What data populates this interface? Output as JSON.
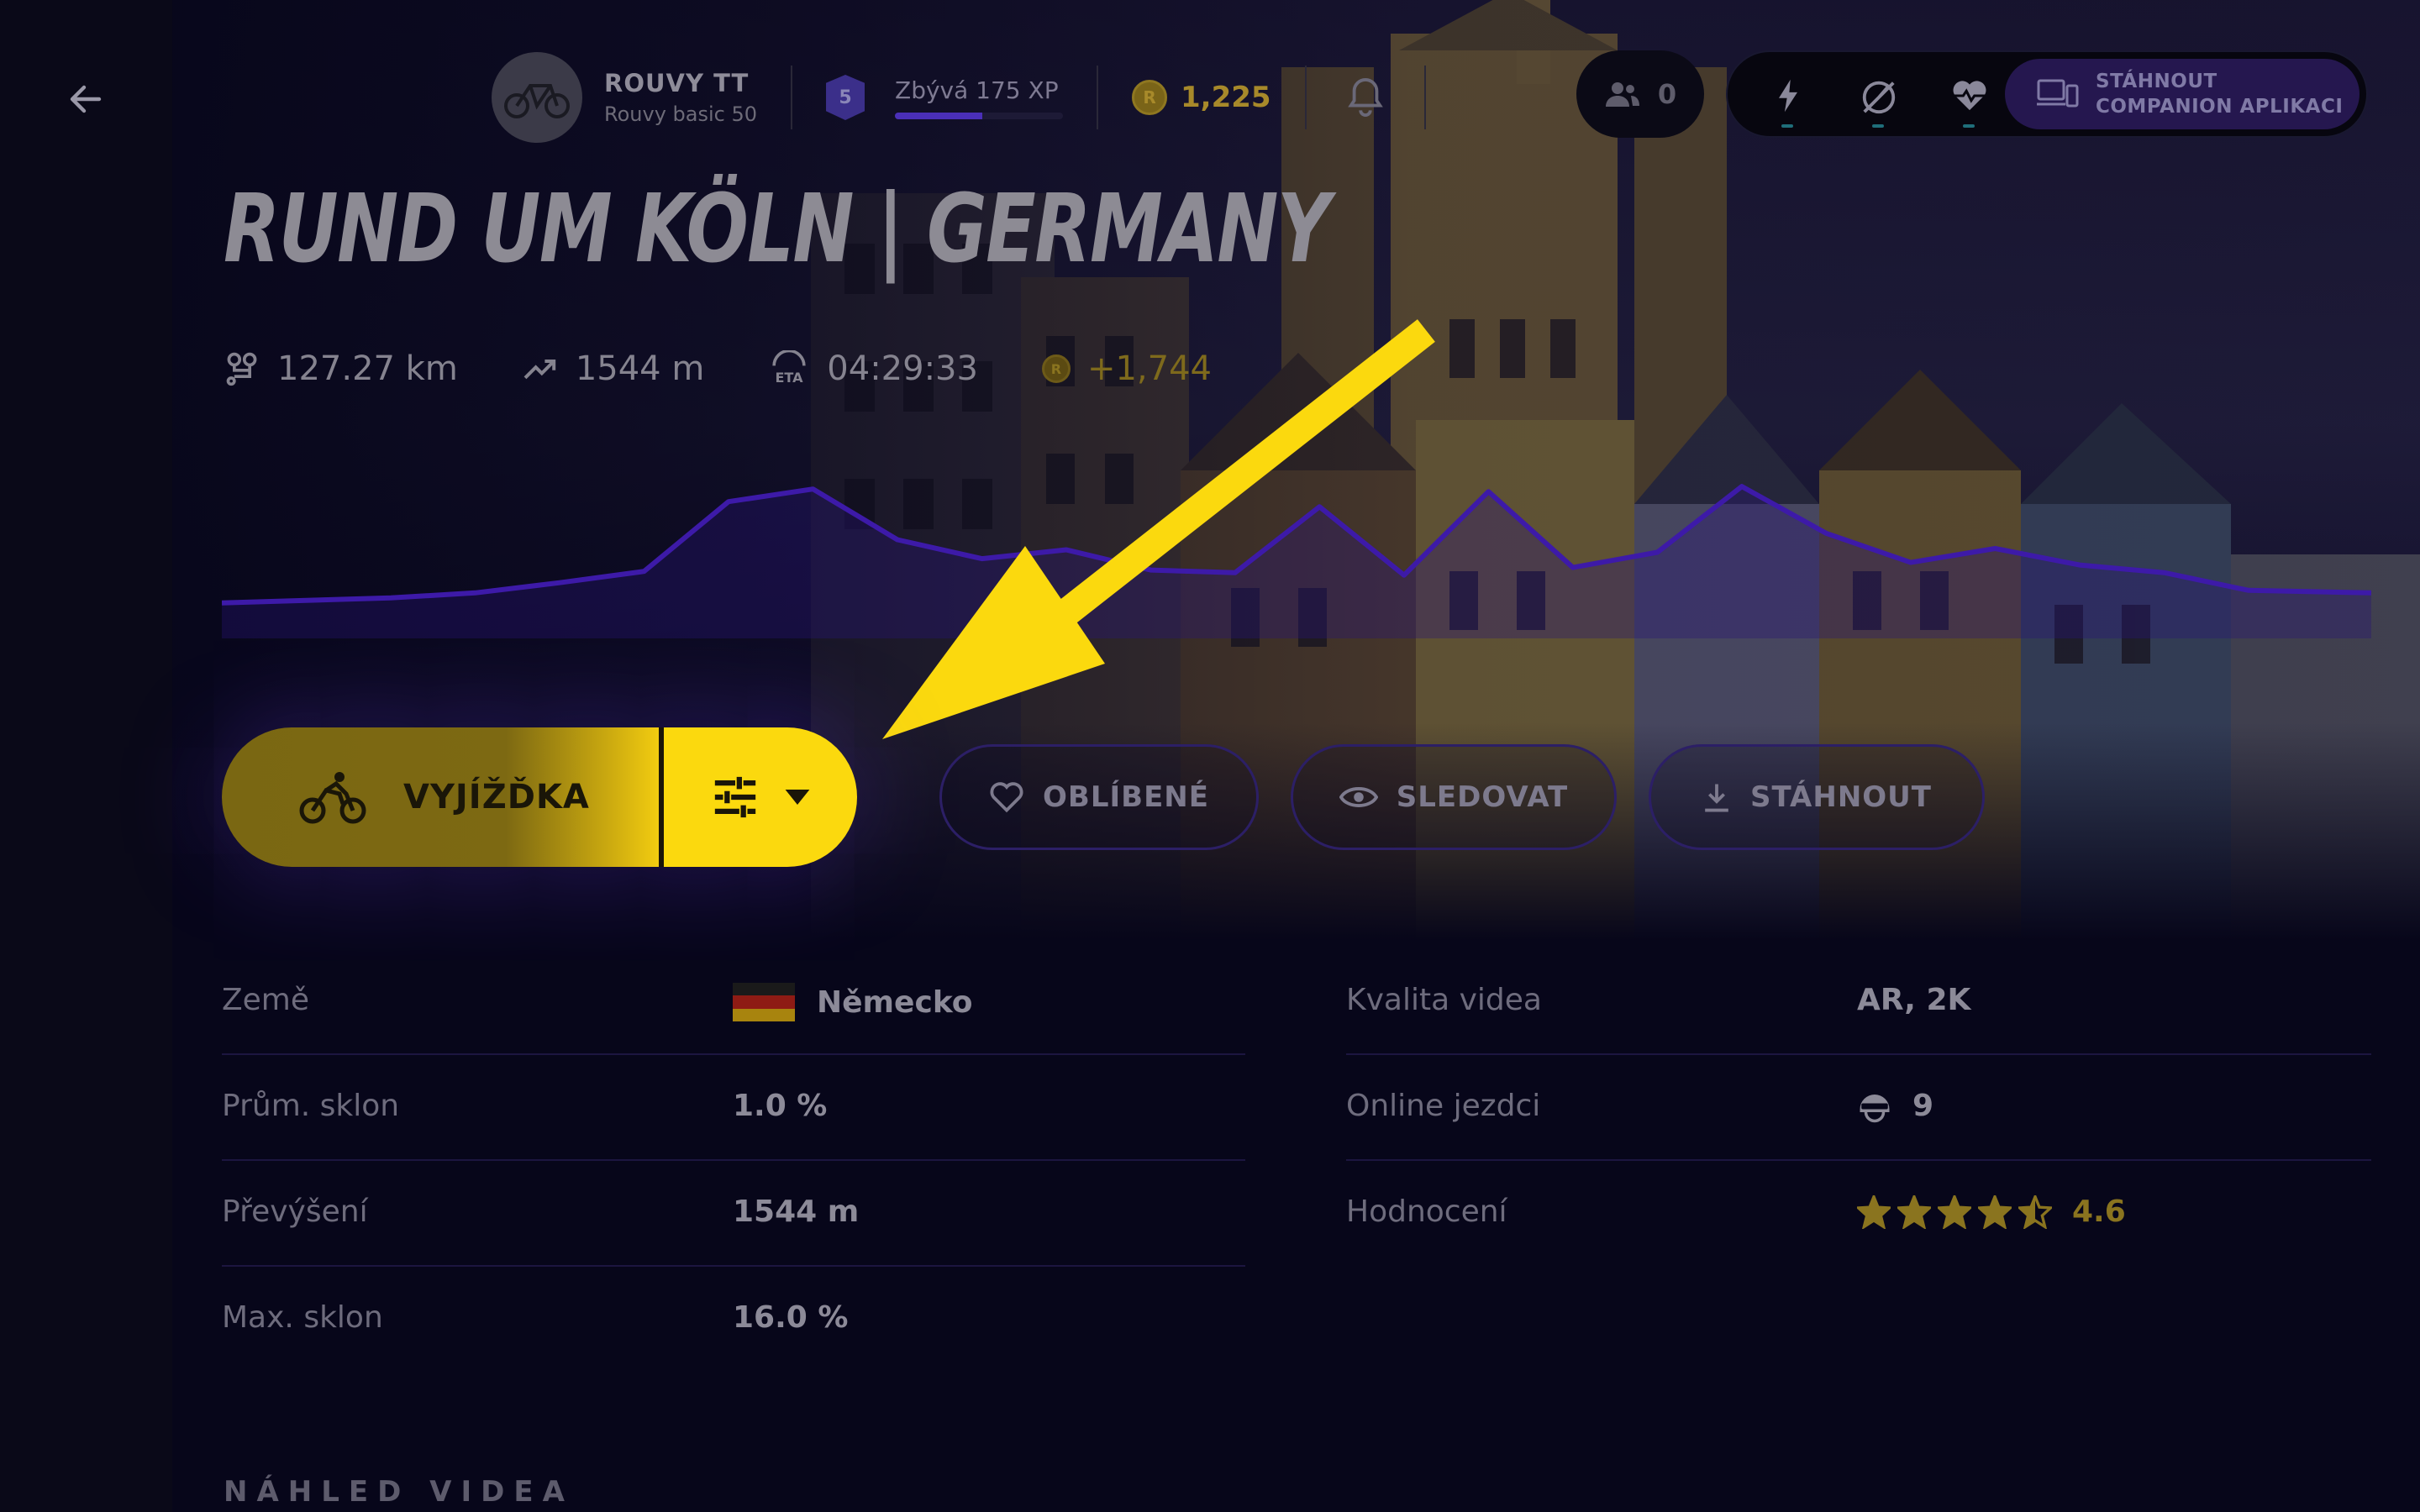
{
  "nav": {
    "back_icon": "arrow-left-icon"
  },
  "user": {
    "bike_name": "ROUVY TT",
    "bike_model": "Rouvy basic 50",
    "level": "5",
    "xp_text": "Zbývá 175 XP",
    "xp_progress_percent": 52,
    "coins": "1,225",
    "coin_glyph": "R",
    "friends_count": "0"
  },
  "companion": {
    "line1": "STÁHNOUT",
    "line2": "COMPANION APLIKACI"
  },
  "route": {
    "title": "RUND UM KÖLN |  GERMANY",
    "distance": "127.27 km",
    "elevation": "1544 m",
    "eta": "04:29:33",
    "reward": "+1,744"
  },
  "chart_data": {
    "type": "area",
    "x": [
      0,
      5,
      10,
      15,
      20,
      25,
      30,
      35,
      40,
      45,
      50,
      55,
      60,
      65,
      70,
      75,
      80,
      85,
      90,
      95,
      100,
      105,
      110,
      115,
      120,
      127.27
    ],
    "y": [
      20,
      22,
      24,
      28,
      36,
      45,
      100,
      110,
      70,
      55,
      62,
      46,
      44,
      96,
      42,
      108,
      48,
      60,
      112,
      75,
      52,
      63,
      50,
      44,
      30,
      28
    ]
  },
  "actions": {
    "ride": "VYJÍŽĎKA",
    "favorite": "OBLÍBENÉ",
    "watch": "SLEDOVAT",
    "download": "STÁHNOUT"
  },
  "info_left": [
    {
      "label": "Země",
      "value": "Německo"
    },
    {
      "label": "Prům. sklon",
      "value": "1.0 %"
    },
    {
      "label": "Převýšení",
      "value": "1544 m"
    },
    {
      "label": "Max. sklon",
      "value": "16.0 %"
    }
  ],
  "info_right": [
    {
      "label": "Kvalita videa",
      "value": "AR, 2K"
    },
    {
      "label": "Online jezdci",
      "value": "9"
    },
    {
      "label": "Hodnocení",
      "value": "4.6"
    }
  ],
  "rating": {
    "stars": 4.5,
    "max": 5
  },
  "section_title": "NÁHLED VIDEA",
  "colors": {
    "accent_yellow": "#fbd90e",
    "purple_line": "#3d1aa8",
    "gold": "#a7892a"
  }
}
